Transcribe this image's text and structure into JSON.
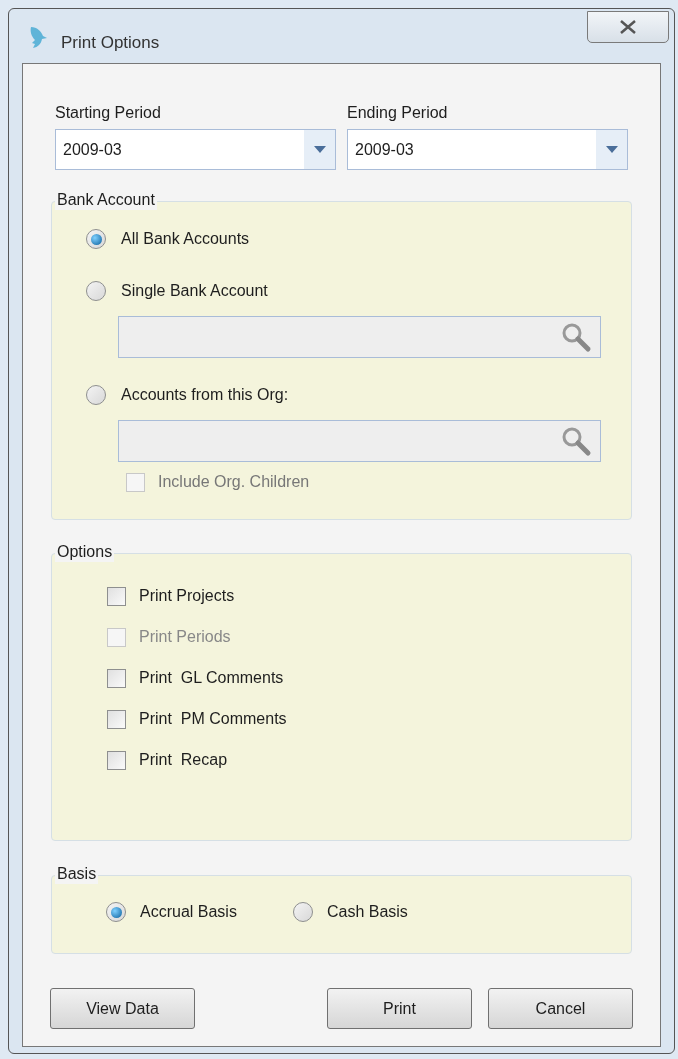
{
  "window": {
    "title": "Print Options"
  },
  "periods": [
    {
      "label": "Starting Period",
      "value": "2009-03"
    },
    {
      "label": "Ending Period",
      "value": "2009-03"
    }
  ],
  "bank_account": {
    "title": "Bank Account",
    "items": [
      {
        "kind": "radio",
        "label": "All Bank Accounts",
        "selected": true
      },
      {
        "kind": "radio",
        "label": "Single Bank Account",
        "selected": false
      },
      {
        "kind": "lookup",
        "disabled": true
      },
      {
        "kind": "radio",
        "label": "Accounts from this Org:",
        "selected": false
      },
      {
        "kind": "lookup",
        "disabled": true
      },
      {
        "kind": "checkbox",
        "label": "Include Org. Children",
        "checked": false,
        "disabled": true
      }
    ]
  },
  "options": {
    "title": "Options",
    "items": [
      {
        "label": "Print Projects",
        "checked": false,
        "disabled": false
      },
      {
        "label": "Print Periods",
        "checked": false,
        "disabled": true
      },
      {
        "label": "Print  GL Comments",
        "checked": false,
        "disabled": false
      },
      {
        "label": "Print  PM Comments",
        "checked": false,
        "disabled": false
      },
      {
        "label": "Print  Recap",
        "checked": false,
        "disabled": false
      }
    ]
  },
  "basis": {
    "title": "Basis",
    "items": [
      {
        "label": "Accrual Basis",
        "selected": true
      },
      {
        "label": "Cash Basis",
        "selected": false
      }
    ]
  },
  "buttons": [
    "View Data",
    "Print",
    "Cancel"
  ]
}
